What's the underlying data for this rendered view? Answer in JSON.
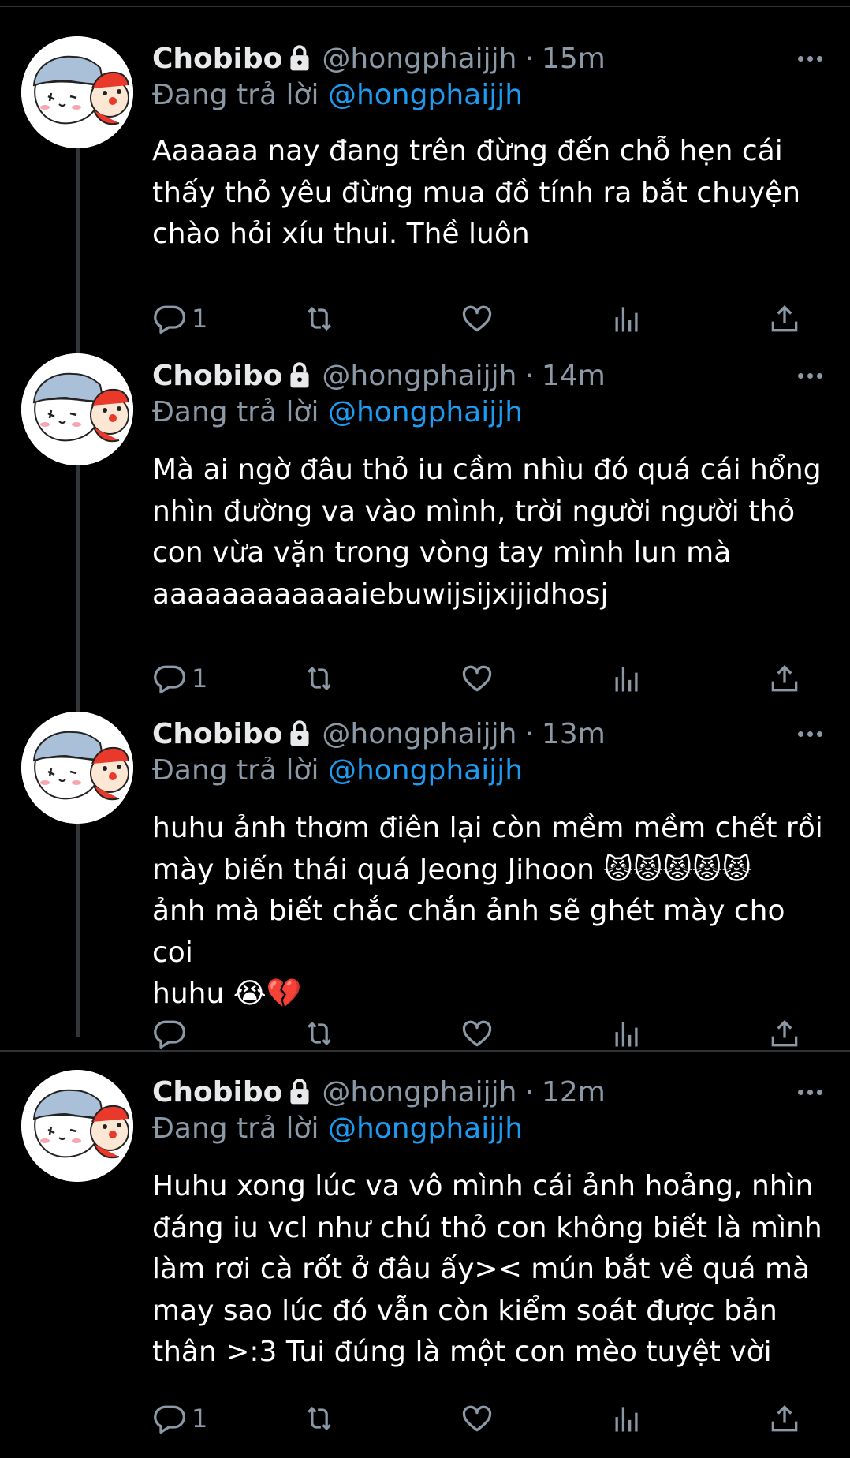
{
  "theme": {
    "background": "#000000",
    "text": "#e7e9ea",
    "muted": "#8b98a5",
    "link": "#1d9bf0"
  },
  "tweets": [
    {
      "name": "Chobibo",
      "handle": "@hongphaijjh",
      "time": "15m",
      "replying_prefix": "Đang trả lời ",
      "replying_to": "@hongphaijjh",
      "text": "Aaaaaa nay đang trên đừng đến chỗ hẹn cái\nthấy thỏ yêu đừng mua đồ tính ra bắt chuyện\nchào hỏi xíu thui. Thề luôn",
      "reply_count": "1"
    },
    {
      "name": "Chobibo",
      "handle": "@hongphaijjh",
      "time": "14m",
      "replying_prefix": "Đang trả lời ",
      "replying_to": "@hongphaijjh",
      "text": "Mà ai ngờ đâu thỏ iu cầm nhìu đó quá cái hổng\nnhìn đường va vào mình, trời người người thỏ\ncon vừa vặn trong vòng tay mình lun mà\naaaaaaaaaaaaiebuwijsijxijidhosj",
      "reply_count": "1"
    },
    {
      "name": "Chobibo",
      "handle": "@hongphaijjh",
      "time": "13m",
      "replying_prefix": "Đang trả lời ",
      "replying_to": "@hongphaijjh",
      "text": "huhu ảnh thơm điên lại còn mềm mềm chết rồi\nmày biến thái quá Jeong Jihoon 😾😾😾😾😾\nảnh mà biết chắc chắn ảnh sẽ ghét mày cho coi\nhuhu 😭💔",
      "reply_count": ""
    },
    {
      "name": "Chobibo",
      "handle": "@hongphaijjh",
      "time": "12m",
      "replying_prefix": "Đang trả lời ",
      "replying_to": "@hongphaijjh",
      "text": "Huhu xong lúc va vô mình cái ảnh hoảng, nhìn\nđáng iu vcl như chú thỏ con không biết là mình\nlàm rơi cà rốt ở đâu ấy>< mún bắt về quá mà\nmay sao lúc đó vẫn còn kiểm soát được bản\nthân >:3 Tui đúng là một con mèo tuyệt vời",
      "reply_count": "1"
    }
  ],
  "icons": [
    "lock-icon",
    "more-icon",
    "reply-icon",
    "retweet-icon",
    "like-icon",
    "views-icon",
    "share-icon"
  ]
}
